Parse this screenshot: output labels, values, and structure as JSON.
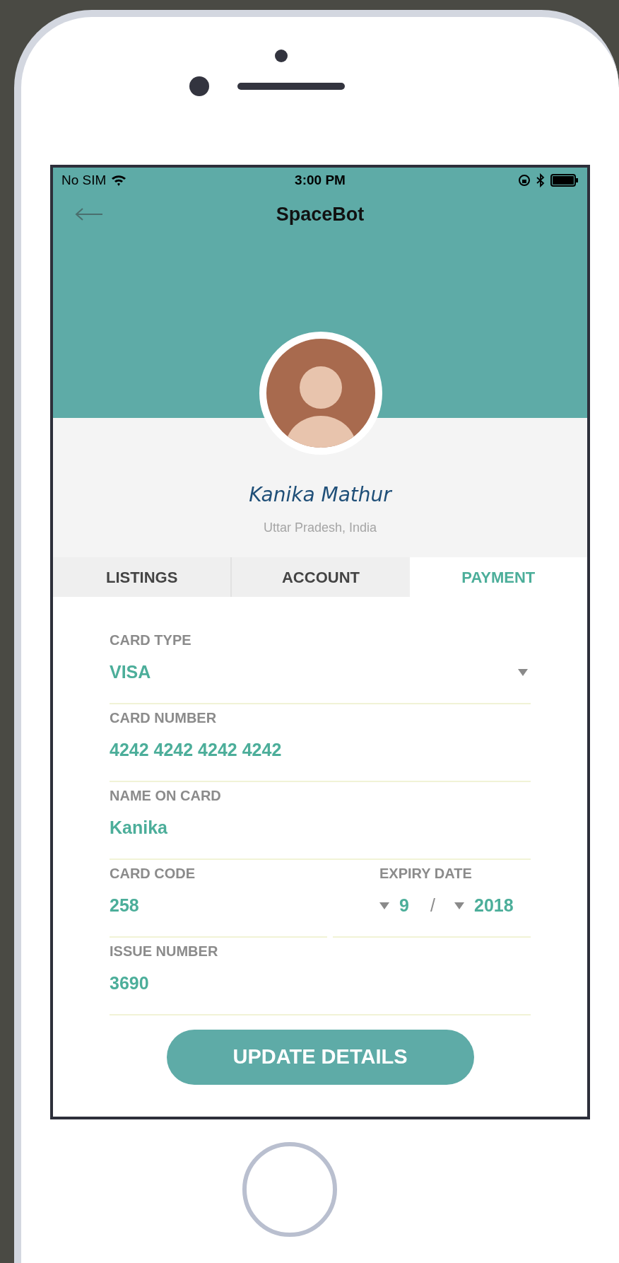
{
  "status_bar": {
    "carrier": "No SIM",
    "time": "3:00 PM"
  },
  "header": {
    "title": "SpaceBot"
  },
  "profile": {
    "name": "Kanika Mathur",
    "location": "Uttar Pradesh, India"
  },
  "tabs": [
    {
      "label": "LISTINGS",
      "selected": false
    },
    {
      "label": "ACCOUNT",
      "selected": false
    },
    {
      "label": "PAYMENT",
      "selected": true
    }
  ],
  "form": [
    {
      "kind": "dropdown",
      "label": "CARD TYPE",
      "value": "VISA"
    },
    {
      "kind": "text",
      "label": "CARD NUMBER",
      "value": "4242 4242 4242 4242"
    },
    {
      "kind": "text",
      "label": "NAME ON CARD",
      "value": "Kanika"
    },
    {
      "kind": "split",
      "left": {
        "label": "CARD CODE",
        "value": "258"
      },
      "right": {
        "label": "EXPIRY DATE",
        "month": "9",
        "separator": "/",
        "year": "2018"
      }
    },
    {
      "kind": "text",
      "label": "ISSUE NUMBER",
      "value": "3690"
    }
  ],
  "button": {
    "label": "UPDATE DETAILS"
  }
}
